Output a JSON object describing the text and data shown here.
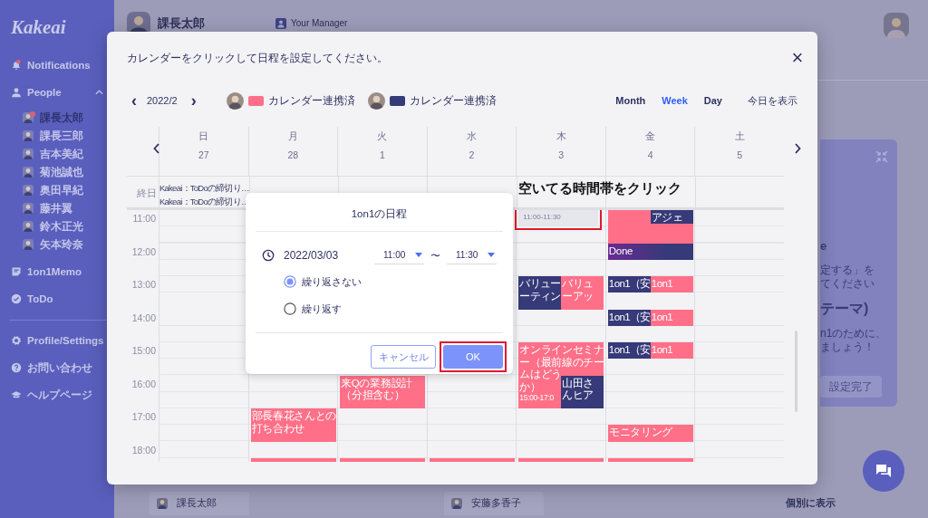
{
  "sidebar": {
    "logo": "Kakeai",
    "items": [
      {
        "kind": "bell",
        "label": "Notifications",
        "badge": true
      },
      {
        "kind": "person",
        "label": "People",
        "expanded": true,
        "members": [
          {
            "name": "課長太郎",
            "selected": true,
            "unread": true
          },
          {
            "name": "課長三郎",
            "selected": false,
            "unread": false
          },
          {
            "name": "吉本美紀",
            "selected": false,
            "unread": false
          },
          {
            "name": "菊池誠也",
            "selected": false,
            "unread": false
          },
          {
            "name": "奥田早紀",
            "selected": false,
            "unread": false
          },
          {
            "name": "藤井翼",
            "selected": false,
            "unread": false
          },
          {
            "name": "鈴木正光",
            "selected": false,
            "unread": false
          },
          {
            "name": "矢本玲奈",
            "selected": false,
            "unread": false
          }
        ]
      },
      {
        "kind": "memo",
        "label": "1on1Memo"
      },
      {
        "kind": "check",
        "label": "ToDo"
      }
    ],
    "footer_items": [
      {
        "kind": "gear",
        "label": "Profile/Settings"
      },
      {
        "kind": "question",
        "label": "お問い合わせ"
      },
      {
        "kind": "cap",
        "label": "ヘルプページ"
      }
    ]
  },
  "header": {
    "user": "課長太郎",
    "role": "Your Manager"
  },
  "card": {
    "lines": [
      {
        "kind": "title",
        "text": "e"
      },
      {
        "kind": "body",
        "text": "定する」を"
      },
      {
        "kind": "body",
        "text": "てください"
      },
      {
        "kind": "heading",
        "text": "テーマ)"
      },
      {
        "kind": "body",
        "text": "n1のために、"
      },
      {
        "kind": "body",
        "text": "ましょう！"
      }
    ],
    "button": "設定完了"
  },
  "bottom": {
    "tabs": [
      "課長太郎",
      "安藤多香子"
    ],
    "link": "個別に表示"
  },
  "modal": {
    "instruction": "カレンダーをクリックして日程を設定してください。",
    "close": "×",
    "prev": "‹",
    "month": "2022/2",
    "next": "›",
    "legend": [
      {
        "label": "カレンダー連携済",
        "color": "#ff7088"
      },
      {
        "label": "カレンダー連携済",
        "color": "#363a78"
      }
    ],
    "views": [
      {
        "label": "Month",
        "selected": false
      },
      {
        "label": "Week",
        "selected": true
      },
      {
        "label": "Day",
        "selected": false
      }
    ],
    "today": "今日を表示",
    "all_day_label": "終日",
    "hours": [
      "11:00",
      "12:00",
      "13:00",
      "14:00",
      "15:00",
      "16:00",
      "17:00",
      "18:00"
    ],
    "annotation": "空いてる時間帯をクリック",
    "days": [
      {
        "name": "日",
        "date": "27",
        "all_day": [
          "Kakeai：ToDoの締切り…",
          "Kakeai：ToDoの締切り…"
        ]
      },
      {
        "name": "月",
        "date": "28",
        "events": [
          {
            "kind": "event",
            "color": "#ff7088",
            "lines": [
              "部長春花さんとの",
              "打ち合わせ"
            ]
          },
          {
            "kind": "event",
            "color": "#ff7088"
          }
        ]
      },
      {
        "name": "火",
        "date": "1",
        "events": [
          {
            "kind": "event",
            "color": "#ff7088",
            "lines": [
              "来Qの業務設計",
              "（分担含む）"
            ]
          },
          {
            "kind": "event",
            "color": "#ff7088"
          }
        ]
      },
      {
        "name": "水",
        "date": "2",
        "events": [
          {
            "kind": "event",
            "color": "#ff7088"
          }
        ]
      },
      {
        "name": "木",
        "date": "3",
        "events": [
          {
            "kind": "slot",
            "text": "11:00-11:30",
            "highlighted": true
          },
          {
            "kind": "event",
            "color": "#363a78",
            "lines": [
              "バリュー",
              "ーティン"
            ]
          },
          {
            "kind": "event",
            "color": "#ff7088",
            "lines": [
              "バリュ",
              "ーアッ"
            ]
          },
          {
            "kind": "event",
            "color": "#ff7088",
            "lines": [
              "オンラインセミナ",
              "ー（最前線のチー",
              "ムはどう",
              "か）"
            ],
            "time": "15:00-17:0"
          },
          {
            "kind": "event",
            "color": "#363a78",
            "lines": [
              "山田さ",
              "んヒア"
            ]
          },
          {
            "kind": "event",
            "color": "#ff7088"
          }
        ]
      },
      {
        "name": "金",
        "date": "4",
        "events": [
          {
            "kind": "event",
            "color": "#ff7088"
          },
          {
            "kind": "event",
            "color": "#363a78",
            "lines": [
              "アジェ"
            ]
          },
          {
            "kind": "event",
            "color": "#363a78",
            "gradient": true,
            "lines": [
              "Done"
            ]
          },
          {
            "kind": "event",
            "color": "#363a78",
            "lines": [
              "1on1（安"
            ]
          },
          {
            "kind": "event",
            "color": "#ff7088",
            "lines": [
              "1on1"
            ]
          },
          {
            "kind": "event",
            "color": "#363a78",
            "lines": [
              "1on1（安"
            ]
          },
          {
            "kind": "event",
            "color": "#ff7088",
            "lines": [
              "1on1"
            ]
          },
          {
            "kind": "event",
            "color": "#363a78",
            "lines": [
              "1on1（安"
            ]
          },
          {
            "kind": "event",
            "color": "#ff7088",
            "lines": [
              "1on1"
            ]
          },
          {
            "kind": "event",
            "color": "#ff7088",
            "lines": [
              "モニタリング"
            ]
          },
          {
            "kind": "event",
            "color": "#ff7088"
          }
        ]
      },
      {
        "name": "土",
        "date": "5"
      }
    ],
    "popup": {
      "title": "1on1の日程",
      "date": "2022/03/03",
      "start": "11:00",
      "separator": "〜",
      "end": "11:30",
      "options": [
        {
          "label": "繰り返さない",
          "selected": true
        },
        {
          "label": "繰り返す",
          "selected": false
        }
      ],
      "cancel": "キャンセル",
      "ok": {
        "label": "OK",
        "highlighted": true
      }
    }
  }
}
